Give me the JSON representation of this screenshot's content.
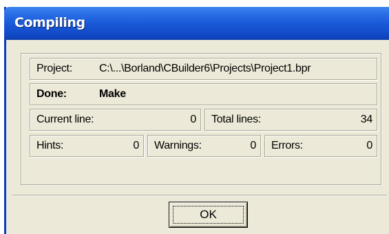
{
  "window": {
    "title": "Compiling"
  },
  "project": {
    "label": "Project:",
    "value": "C:\\...\\Borland\\CBuilder6\\Projects\\Project1.bpr"
  },
  "status": {
    "label": "Done:",
    "value": "Make"
  },
  "lines": {
    "current_label": "Current line:",
    "current_value": "0",
    "total_label": "Total lines:",
    "total_value": "34"
  },
  "counts": {
    "hints_label": "Hints:",
    "hints_value": "0",
    "warnings_label": "Warnings:",
    "warnings_value": "0",
    "errors_label": "Errors:",
    "errors_value": "0"
  },
  "buttons": {
    "ok_label": "OK"
  },
  "colors": {
    "titlebar": "#1856d6",
    "face": "#ece9d8"
  }
}
